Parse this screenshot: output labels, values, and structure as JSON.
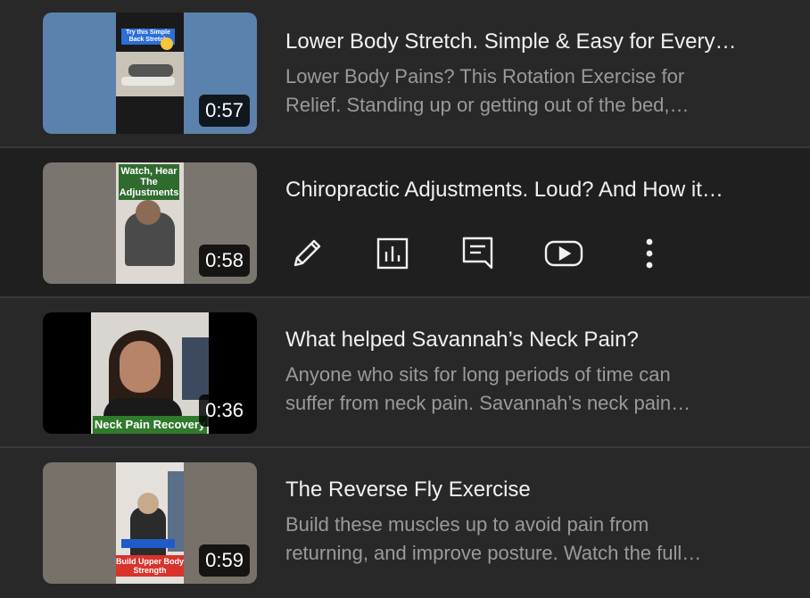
{
  "videos": [
    {
      "title": "Lower Body Stretch. Simple & Easy for Every…",
      "description_line1": "Lower Body Pains? This Rotation Exercise for",
      "description_line2": "Relief. Standing up or getting out of the bed,…",
      "duration": "0:57",
      "thumb_caption": "Try this Simple Back Stretch",
      "thumb_bg": "#5b82ad"
    },
    {
      "title": "Chiropractic Adjustments. Loud? And How it…",
      "duration": "0:58",
      "thumb_caption": "Watch, Hear The Adjustments",
      "thumb_bg": "#7a756f",
      "actions": [
        "pencil-icon",
        "analytics-icon",
        "comments-icon",
        "youtube-icon",
        "more-vert-icon"
      ]
    },
    {
      "title": "What helped Savannah’s Neck Pain?",
      "description_line1": "Anyone who sits for long periods of time can",
      "description_line2": "suffer from neck pain. Savannah’s neck pain…",
      "duration": "0:36",
      "thumb_caption": "Neck Pain Recovery",
      "thumb_bg": "#000000"
    },
    {
      "title": "The Reverse Fly Exercise",
      "description_line1": "Build these muscles up to avoid pain from",
      "description_line2": "returning, and improve posture. Watch the full…",
      "duration": "0:59",
      "thumb_caption": "Build Upper Body Strength",
      "thumb_bg": "#78716a"
    }
  ],
  "colors": {
    "background": "#282828",
    "hover_row": "#1f1f1f",
    "title": "#f1f1f1",
    "description": "#9a9a9a"
  }
}
